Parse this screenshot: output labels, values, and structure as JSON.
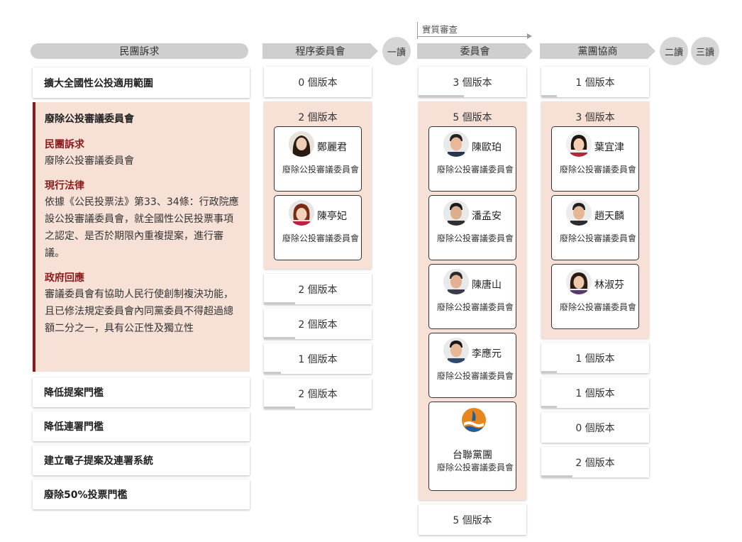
{
  "headers": {
    "demands": "民團訴求",
    "procedure": "程序委員會",
    "first_reading": "一讀",
    "committee": "委員會",
    "caucus": "黨團協商",
    "second_reading": "二讀",
    "third_reading": "三讀",
    "substantive_review": "實質審查"
  },
  "demands": {
    "item1": "擴大全國性公投適用範圍",
    "expanded": {
      "title": "廢除公投審議委員會",
      "demand_heading": "民團訴求",
      "demand_text": "廢除公投審議委員會",
      "law_heading": "現行法律",
      "law_text": "依據《公民投票法》第33、34條：行政院應設公投審議委員會，就全國性公民投票事項之認定、是否於期限內重複提案，進行審議。",
      "gov_heading": "政府回應",
      "gov_text": "審議委員會有協助人民行使創制複決功能，且已修法規定委員會內同黨委員不得超過總額二分之一，具有公正性及獨立性"
    },
    "item3": "降低提案門檻",
    "item4": "降低連署門檻",
    "item5": "建立電子提案及連署系統",
    "item6": "廢除50%投票門檻"
  },
  "procedure": {
    "row1": "0 個版本",
    "panel_title": "2 個版本",
    "legislators": [
      {
        "name": "鄭麗君",
        "desc": "廢除公投審議委員會"
      },
      {
        "name": "陳亭妃",
        "desc": "廢除公投審議委員會"
      }
    ],
    "row3": "2 個版本",
    "row4": "2 個版本",
    "row5": "1 個版本",
    "row6": "2 個版本"
  },
  "committee": {
    "row1": "3 個版本",
    "panel_title": "5 個版本",
    "legislators": [
      {
        "name": "陳歐珀",
        "desc": "廢除公投審議委員會"
      },
      {
        "name": "潘孟安",
        "desc": "廢除公投審議委員會"
      },
      {
        "name": "陳唐山",
        "desc": "廢除公投審議委員會"
      },
      {
        "name": "李應元",
        "desc": "廢除公投審議委員會"
      }
    ],
    "party": {
      "name": "台聯黨團",
      "desc": "廢除公投審議委員會"
    },
    "row7": "5 個版本"
  },
  "caucus": {
    "row1": "1 個版本",
    "panel_title": "3 個版本",
    "legislators": [
      {
        "name": "葉宜津",
        "desc": "廢除公投審議委員會"
      },
      {
        "name": "趙天麟",
        "desc": "廢除公投審議委員會"
      },
      {
        "name": "林淑芬",
        "desc": "廢除公投審議委員會"
      }
    ],
    "row3": "1 個版本",
    "row4": "1 個版本",
    "row5": "0 個版本",
    "row6": "2 個版本"
  },
  "colors": {
    "accent": "#8b1a1a",
    "highlight_bg": "#f7e1d7",
    "header_bg": "#cfcfcf"
  }
}
